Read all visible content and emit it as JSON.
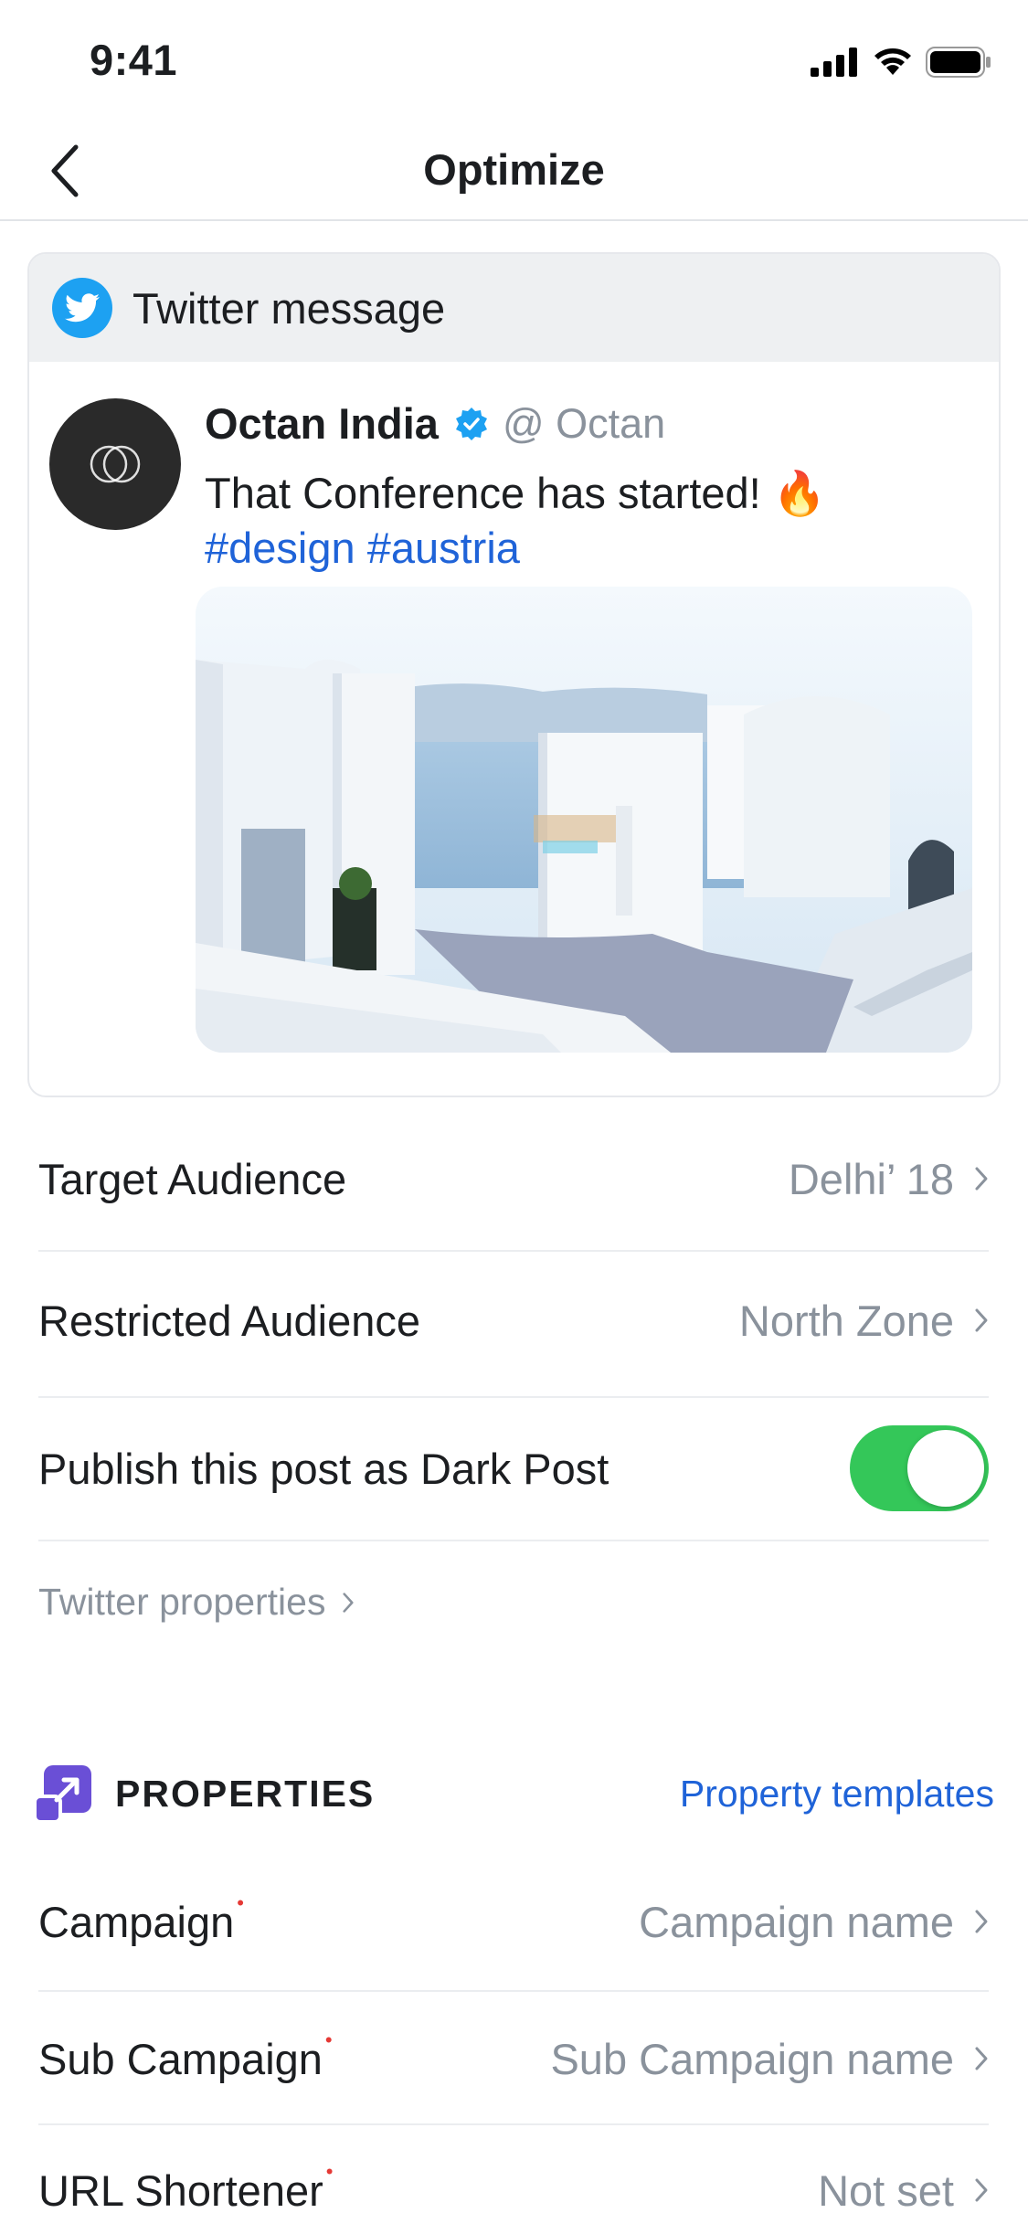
{
  "status_bar": {
    "time": "9:41"
  },
  "nav": {
    "title": "Optimize"
  },
  "card": {
    "header_label": "Twitter message",
    "author": "Octan India",
    "handle": "@ Octan",
    "tweet_text": "That Conference has started! 🔥",
    "hashtags": "#design #austria"
  },
  "rows": {
    "target_audience": {
      "label": "Target Audience",
      "value": "Delhi’ 18"
    },
    "restricted_audience": {
      "label": "Restricted Audience",
      "value": "North Zone"
    },
    "dark_post": {
      "label": "Publish this post as Dark Post",
      "enabled": true
    }
  },
  "twitter_properties": "Twitter properties",
  "properties": {
    "title": "PROPERTIES",
    "templates_link": "Property templates",
    "campaign": {
      "label": "Campaign",
      "value": "Campaign name"
    },
    "sub_campaign": {
      "label": "Sub Campaign",
      "value": "Sub Campaign name"
    },
    "url_shortener": {
      "label": "URL Shortener",
      "value": "Not set"
    },
    "required_mark": "•"
  },
  "colors": {
    "accent": "#1f63d8",
    "toggle_on": "#34c759",
    "twitter": "#1da1f2",
    "properties_icon": "#6a4fd6"
  },
  "icons": [
    "back-chevron-icon",
    "signal-icon",
    "wifi-icon",
    "battery-icon",
    "twitter-bird-icon",
    "verified-icon",
    "chevron-right-icon",
    "properties-icon"
  ]
}
